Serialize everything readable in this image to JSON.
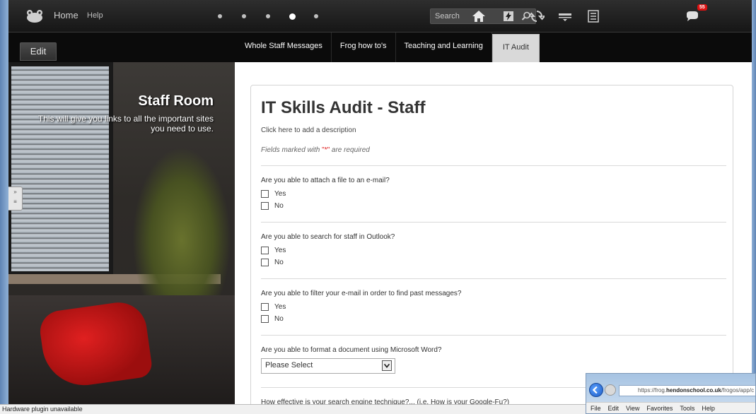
{
  "topbar": {
    "home_label": "Home",
    "help_label": "Help",
    "search_placeholder": "Search",
    "notification_count": "55",
    "icons": [
      "home-icon",
      "flash-icon",
      "sync-icon",
      "keyboard-icon",
      "list-icon",
      "chat-icon"
    ]
  },
  "navbar": {
    "edit_label": "Edit",
    "tabs": [
      {
        "label": "Whole Staff Messages",
        "active": false
      },
      {
        "label": "Frog how to's",
        "active": false
      },
      {
        "label": "Teaching and Learning",
        "active": false
      },
      {
        "label": "IT Audit",
        "active": true
      }
    ]
  },
  "banner": {
    "title": "Staff Room",
    "text": "This will give you links to all the important sites you need to use."
  },
  "form": {
    "title": "IT Skills Audit - Staff",
    "description": "Click here to add a description",
    "required_prefix": "Fields marked with ",
    "required_mark": "\"*\"",
    "required_suffix": " are required",
    "questions": [
      {
        "text": "Are you able to attach a file to an e-mail?",
        "options": [
          "Yes",
          "No"
        ]
      },
      {
        "text": "Are you able to search for staff in Outlook?",
        "options": [
          "Yes",
          "No"
        ]
      },
      {
        "text": "Are you able to filter your e-mail in order to find past messages?",
        "options": [
          "Yes",
          "No"
        ]
      },
      {
        "text": "Are you able to format a document using Microsoft Word?",
        "select_value": "Please Select"
      },
      {
        "text": "How effective is your search engine technique?... (i.e. How is your Google-Fu?)"
      }
    ]
  },
  "statusbar": {
    "text": "Hardware plugin unavailable"
  },
  "ie_inset": {
    "address_prefix": "https://frog.",
    "address_bold": "hendonschool.co.uk",
    "address_suffix": "/frogos/app/c",
    "menu": [
      "File",
      "Edit",
      "View",
      "Favorites",
      "Tools",
      "Help"
    ]
  },
  "colors": {
    "topbar": "#1f1f1f",
    "badge": "#dd1111",
    "active_tab": "#d9d9d9",
    "sofa_cushion": "#d01a1a"
  }
}
